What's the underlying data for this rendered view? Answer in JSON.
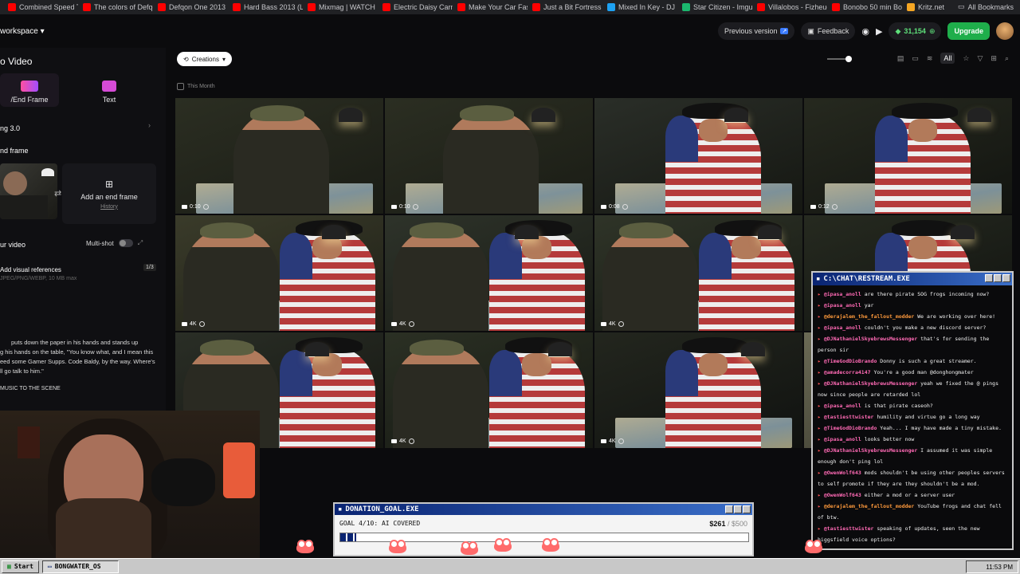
{
  "bookmarks": {
    "items": [
      {
        "label": "Combined Speed Tu...",
        "color": "#ff0000"
      },
      {
        "label": "The colors of Defqo...",
        "color": "#ff0000"
      },
      {
        "label": "Defqon One 2013 H...",
        "color": "#ff0000"
      },
      {
        "label": "Hard Bass 2013 (Liv...",
        "color": "#ff0000"
      },
      {
        "label": "Mixmag | WATCH D...",
        "color": "#ff0000"
      },
      {
        "label": "Electric Daisy Carniv...",
        "color": "#ff0000"
      },
      {
        "label": "Make Your Car Fast...",
        "color": "#ff0000"
      },
      {
        "label": "Just a Bit Fortress -...",
        "color": "#ff0000"
      },
      {
        "label": "Mixed In Key - DJ S...",
        "color": "#1da1f2"
      },
      {
        "label": "Star Citizen - Imgur",
        "color": "#1bb76e"
      },
      {
        "label": "Villalobos - Fizheue...",
        "color": "#ff0000"
      },
      {
        "label": "Bonobo 50 min Boil...",
        "color": "#ff0000"
      },
      {
        "label": "Kritz.net",
        "color": "#f5a623"
      }
    ],
    "all_label": "All Bookmarks"
  },
  "topbar": {
    "workspace": "workspace",
    "previous_version": "Previous version",
    "feedback": "Feedback",
    "credits": "31,154",
    "upgrade": "Upgrade"
  },
  "sidebar": {
    "title": "o Video",
    "mode_frame": "/End Frame",
    "mode_text": "Text",
    "model": "ng 3.0",
    "end_frame_heading": "nd frame",
    "add_end_frame": "Add an end frame",
    "history": "History",
    "your_video": "ur video",
    "multi_shot": "Multi-shot",
    "add_refs": "Add visual references",
    "refs_count": "1/3",
    "refs_formats": "JPEG/PNG/WEBP, 10 MB max",
    "prompt_lines": [
      "puts down the paper in his hands and stands up",
      "g his hands on the table, \"You know what, and I mean this",
      "eed some Gamer Supps. Code Baldy, by the way. Where's",
      "ll go talk to him.\""
    ],
    "music_line": "MUSIC TO THE SCENE"
  },
  "main": {
    "creations_label": "Creations",
    "this_month": "This Month",
    "filter_all": "All"
  },
  "grid": {
    "cells": [
      {
        "badge": "0:10",
        "kind": "video",
        "subject": "soldier"
      },
      {
        "badge": "0:10",
        "kind": "video",
        "subject": "soldier"
      },
      {
        "badge": "0:08",
        "kind": "video",
        "subject": "cowboy"
      },
      {
        "badge": "0:12",
        "kind": "video",
        "subject": "cowboy"
      },
      {
        "badge": "4K",
        "kind": "image",
        "subject": "both"
      },
      {
        "badge": "4K",
        "kind": "image",
        "subject": "both"
      },
      {
        "badge": "4K",
        "kind": "image",
        "subject": "both"
      },
      {
        "badge": "",
        "kind": "image",
        "subject": "cowboy"
      },
      {
        "badge": "",
        "kind": "image",
        "subject": "both"
      },
      {
        "badge": "4K",
        "kind": "image",
        "subject": "both"
      },
      {
        "badge": "4K",
        "kind": "image",
        "subject": "cowboy"
      },
      {
        "badge": "",
        "kind": "image",
        "subject": "soldier"
      }
    ]
  },
  "chat": {
    "title": "C:\\CHAT\\RESTREAM.EXE",
    "messages": [
      {
        "user": "@ipasa_anoll",
        "text": "are there pirate SOG frogs incoming now?"
      },
      {
        "user": "@ipasa_anoll",
        "text": "yar"
      },
      {
        "user": "@derajalem_the_fallout_modder",
        "text": "We are working over here!"
      },
      {
        "user": "@ipasa_anoll",
        "text": "couldn't you make a new discord server?"
      },
      {
        "user": "@DJNathanielSkyebrewsMessenger",
        "text": "that's for sending the person sir"
      },
      {
        "user": "@TimeGodDioBrando",
        "text": "Donny is such a great streamer."
      },
      {
        "user": "@amadecorra4147",
        "text": "You're a good man @donghongmater"
      },
      {
        "user": "@DJNathanielSkyebrewsMessenger",
        "text": "yeah we fixed the @ pings now since people are retarded lol"
      },
      {
        "user": "@ipasa_anoll",
        "text": "is that pirate caseoh?"
      },
      {
        "user": "@tastiesttwister",
        "text": "humility and virtue go a long way"
      },
      {
        "user": "@TimeGodDioBrando",
        "text": "Yeah... I may have made a tiny mistake."
      },
      {
        "user": "@ipasa_anoll",
        "text": "looks better now"
      },
      {
        "user": "@DJNathanielSkyebrewsMessenger",
        "text": "I assumed it was simple enough don't ping lol"
      },
      {
        "user": "@OwenWolf643",
        "text": "mods shouldn't be using other peoples servers to self promote if they are they shouldn't be a mod."
      },
      {
        "user": "@OwenWolf643",
        "text": "either a mod or a server user"
      },
      {
        "user": "@derajalem_the_fallout_modder",
        "text": "YouTube frogs and chat fell of btw."
      },
      {
        "user": "@tastiesttwister",
        "text": "speaking of updates, seen the new higgsfield voice options?"
      }
    ]
  },
  "donation": {
    "title": "DONATION_GOAL.EXE",
    "goal_label": "GOAL 4/10: AI COVERED",
    "amount": "$261",
    "target": "/ $500",
    "progress": 0.04
  },
  "taskbar": {
    "start": "Start",
    "app": "BONGWATER_OS",
    "clock": "11:53 PM"
  }
}
